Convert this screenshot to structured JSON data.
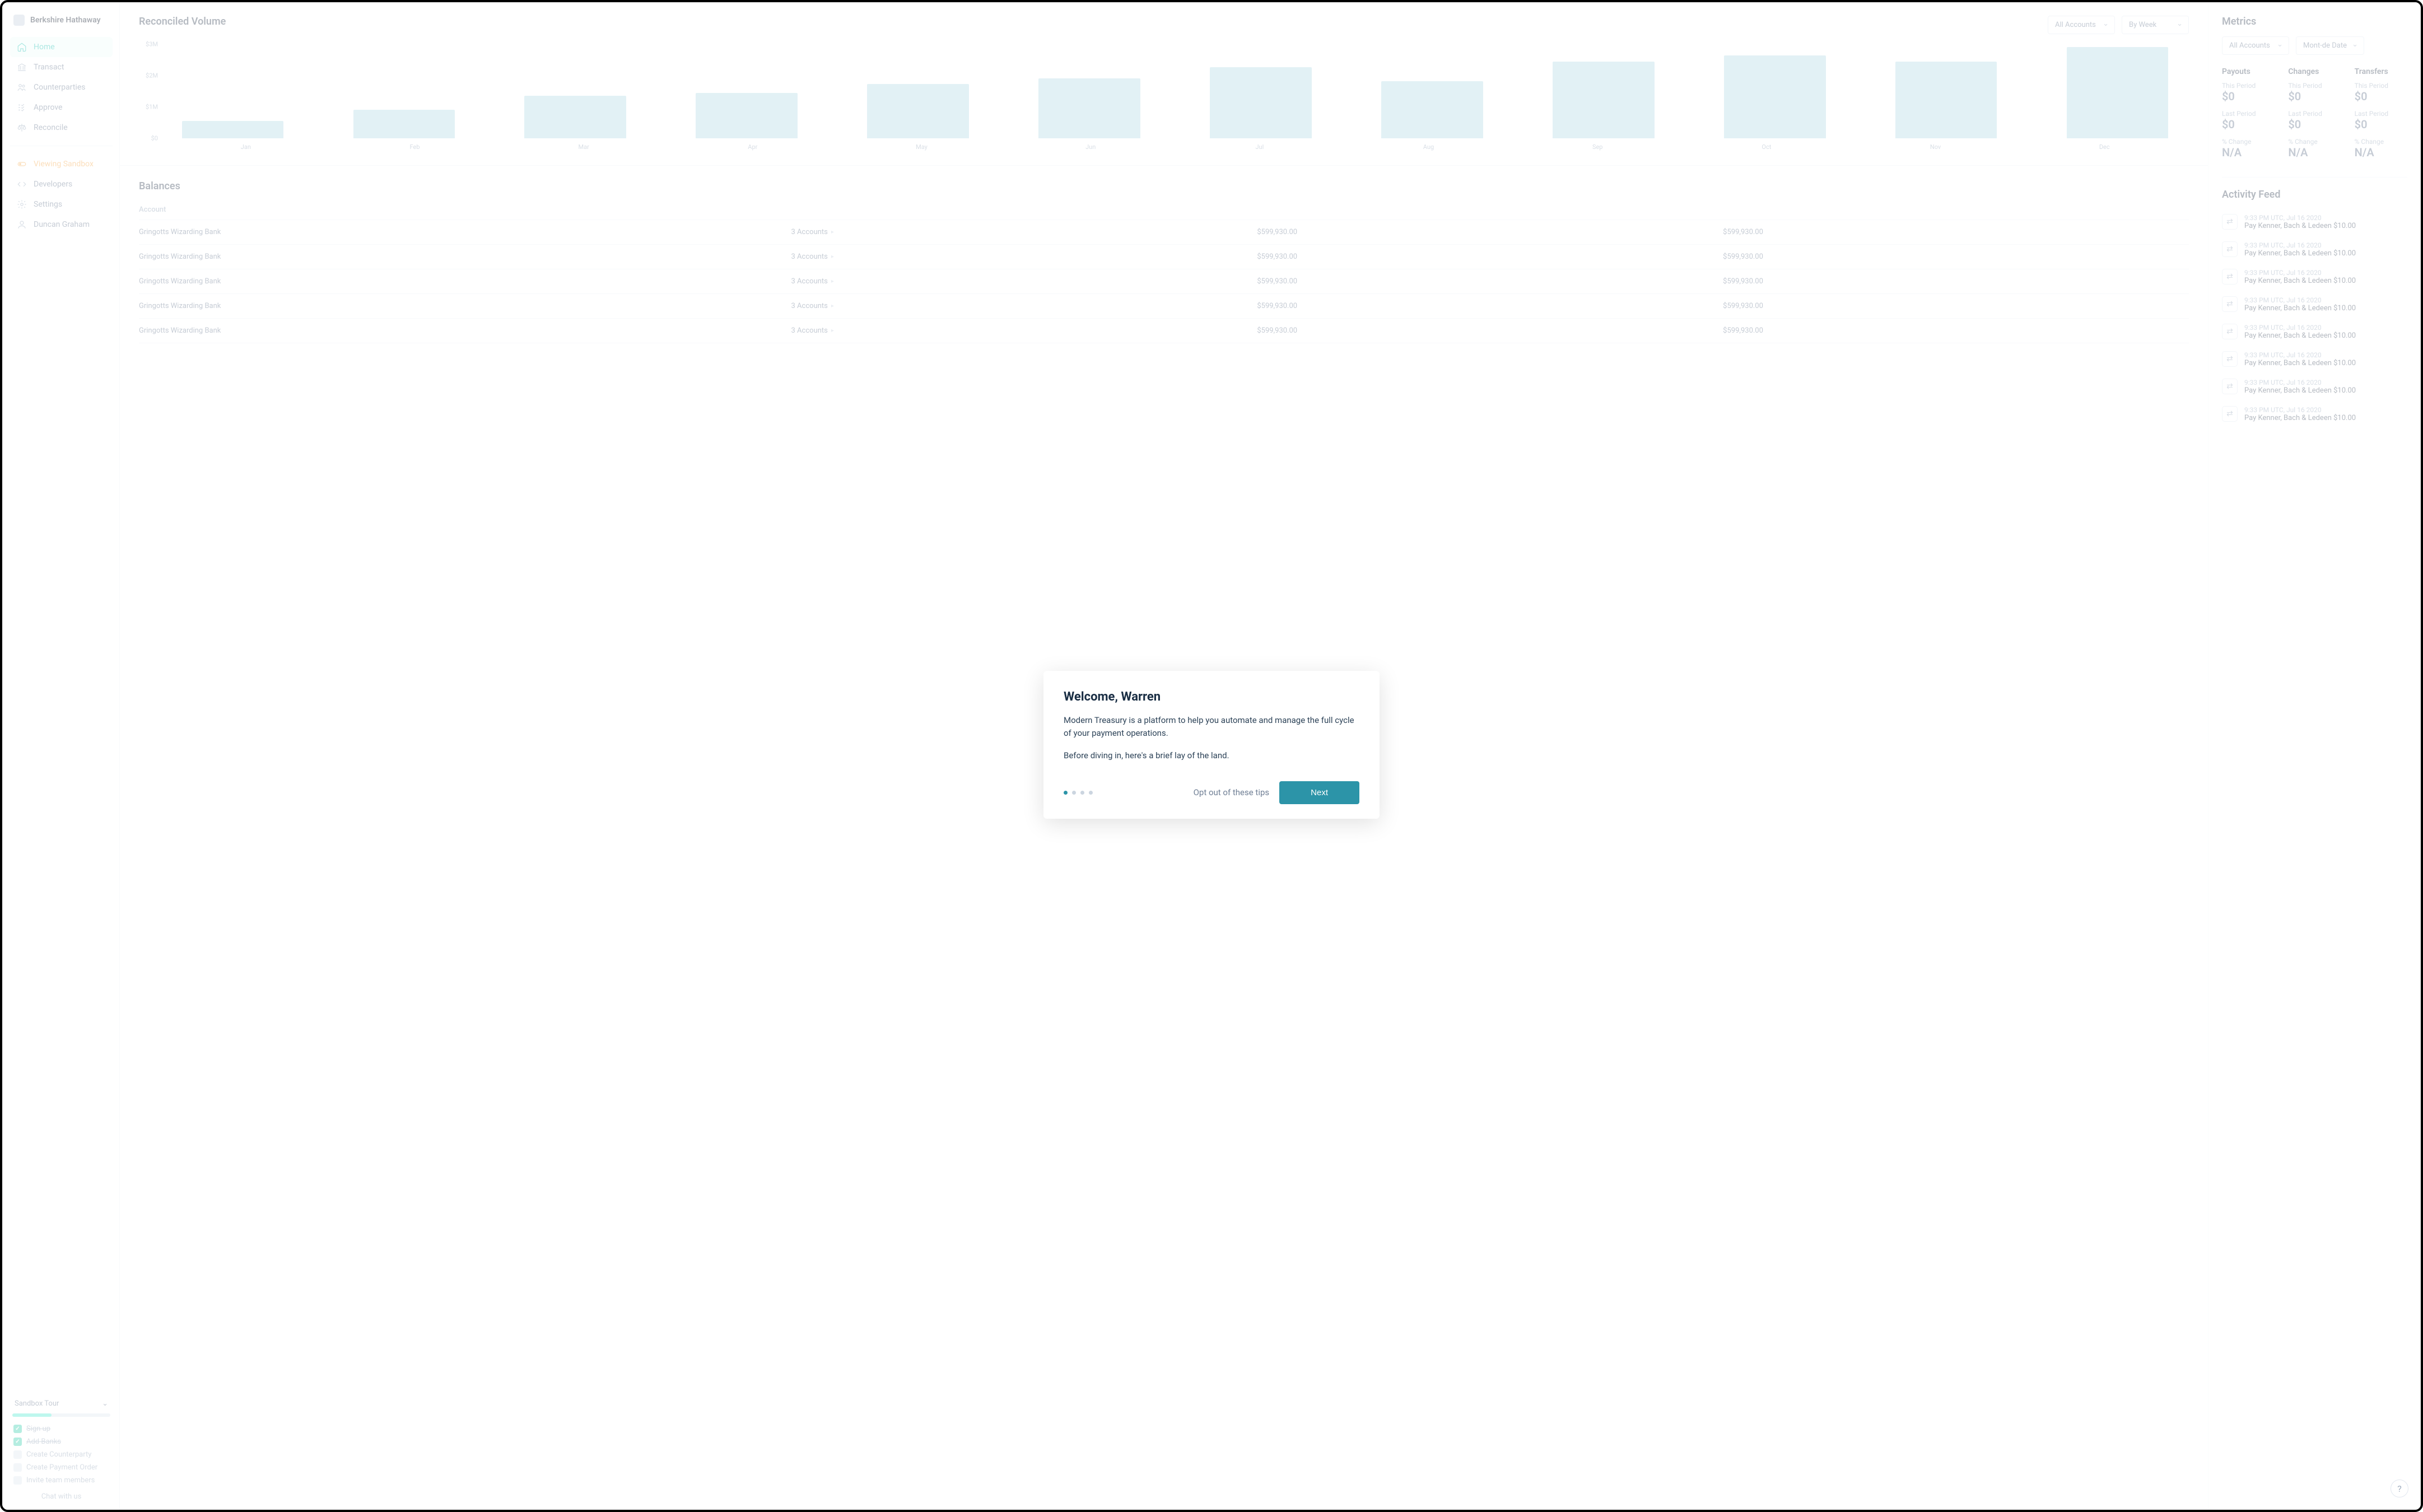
{
  "org": {
    "name": "Berkshire Hathaway"
  },
  "sidebar": {
    "items": [
      {
        "label": "Home"
      },
      {
        "label": "Transact"
      },
      {
        "label": "Counterparties"
      },
      {
        "label": "Approve"
      },
      {
        "label": "Reconcile"
      }
    ],
    "sandbox_label": "Viewing Sandbox",
    "secondary": [
      {
        "label": "Developers"
      },
      {
        "label": "Settings"
      },
      {
        "label": "Duncan Graham"
      }
    ]
  },
  "tour": {
    "title": "Sandbox Tour",
    "progress_pct": 40,
    "items": [
      {
        "label": "Sign up",
        "done": true
      },
      {
        "label": "Add Banks",
        "done": true
      },
      {
        "label": "Create Counterparty",
        "done": false
      },
      {
        "label": "Create Payment Order",
        "done": false
      },
      {
        "label": "Invite team members",
        "done": false
      }
    ],
    "chat": "Chat with us"
  },
  "reconciled": {
    "title": "Reconciled Volume",
    "dropdown_accounts": "All Accounts",
    "dropdown_period": "By Week"
  },
  "chart_data": {
    "type": "bar",
    "categories": [
      "Jan",
      "Feb",
      "Mar",
      "Apr",
      "May",
      "Jun",
      "Jul",
      "Aug",
      "Sep",
      "Oct",
      "Nov",
      "Dec"
    ],
    "values": [
      0.6,
      1.0,
      1.5,
      1.6,
      1.9,
      2.1,
      2.5,
      2.0,
      2.7,
      2.9,
      2.7,
      3.2
    ],
    "ylabel": "$M",
    "yticks": [
      "$0",
      "$1M",
      "$2M",
      "$3M"
    ],
    "ylim": [
      0,
      3.3
    ]
  },
  "balances": {
    "title": "Balances",
    "columns": [
      "Account",
      "",
      "",
      ""
    ],
    "col0_label": "Account",
    "rows": [
      {
        "bank": "Gringotts Wizarding Bank",
        "accounts": "3 Accounts",
        "c1": "$599,930.00",
        "c2": "$599,930.00"
      },
      {
        "bank": "Gringotts Wizarding Bank",
        "accounts": "3 Accounts",
        "c1": "$599,930.00",
        "c2": "$599,930.00"
      },
      {
        "bank": "Gringotts Wizarding Bank",
        "accounts": "3 Accounts",
        "c1": "$599,930.00",
        "c2": "$599,930.00"
      },
      {
        "bank": "Gringotts Wizarding Bank",
        "accounts": "3 Accounts",
        "c1": "$599,930.00",
        "c2": "$599,930.00"
      },
      {
        "bank": "Gringotts Wizarding Bank",
        "accounts": "3 Accounts",
        "c1": "$599,930.00",
        "c2": "$599,930.00"
      }
    ]
  },
  "metrics": {
    "title": "Metrics",
    "dd_accounts": "All Accounts",
    "dd_date": "Mont-de Date",
    "cols": [
      {
        "title": "Payouts",
        "this_label": "This Period",
        "this": "$0",
        "last_label": "Last Period",
        "last": "$0",
        "pct_label": "% Change",
        "pct": "N/A"
      },
      {
        "title": "Changes",
        "this_label": "This Period",
        "this": "$0",
        "last_label": "Last Period",
        "last": "$0",
        "pct_label": "% Change",
        "pct": "N/A"
      },
      {
        "title": "Transfers",
        "this_label": "This Period",
        "this": "$0",
        "last_label": "Last Period",
        "last": "$0",
        "pct_label": "% Change",
        "pct": "N/A"
      }
    ]
  },
  "feed": {
    "title": "Activity  Feed",
    "items": [
      {
        "time": "9:33 PM UTC, Jul 16 2020",
        "text": "Pay Kenner, Bach & Ledeen $10.00"
      },
      {
        "time": "9:33 PM UTC, Jul 16 2020",
        "text": "Pay Kenner, Bach & Ledeen $10.00"
      },
      {
        "time": "9:33 PM UTC, Jul 16 2020",
        "text": "Pay Kenner, Bach & Ledeen $10.00"
      },
      {
        "time": "9:33 PM UTC, Jul 16 2020",
        "text": "Pay Kenner, Bach & Ledeen $10.00"
      },
      {
        "time": "9:33 PM UTC, Jul 16 2020",
        "text": "Pay Kenner, Bach & Ledeen $10.00"
      },
      {
        "time": "9:33 PM UTC, Jul 16 2020",
        "text": "Pay Kenner, Bach & Ledeen $10.00"
      },
      {
        "time": "9:33 PM UTC, Jul 16 2020",
        "text": "Pay Kenner, Bach & Ledeen $10.00"
      },
      {
        "time": "9:33 PM UTC, Jul 16 2020",
        "text": "Pay Kenner, Bach & Ledeen $10.00"
      }
    ]
  },
  "modal": {
    "title": "Welcome, Warren",
    "p1": "Modern Treasury is a platform to help you automate and manage the full cycle of your payment operations.",
    "p2": "Before diving in, here's a brief lay of the land.",
    "opt_out": "Opt out of these tips",
    "next": "Next",
    "step": 1,
    "total": 4
  },
  "help_label": "?"
}
